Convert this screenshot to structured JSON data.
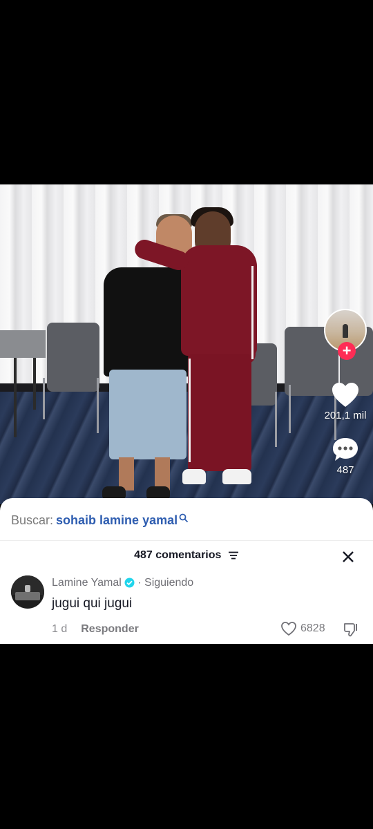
{
  "video": {
    "likes_count": "201,1 mil",
    "comments_count": "487"
  },
  "search": {
    "label": "Buscar:",
    "term": "sohaib lamine yamal"
  },
  "comments_sheet": {
    "header": "487 comentarios",
    "comments": [
      {
        "author": "Lamine Yamal",
        "status": "· Siguiendo",
        "text": "jugui qui jugui",
        "age": "1 d",
        "reply_label": "Responder",
        "likes": "6828"
      }
    ]
  },
  "colors": {
    "follow_red": "#fe2c55",
    "search_blue": "#2e5db0",
    "verified_blue": "#20d5ec"
  },
  "icons": [
    "plus-icon",
    "heart-icon",
    "comment-bubble-icon",
    "search-icon",
    "filter-icon",
    "close-icon",
    "verified-icon",
    "like-icon",
    "dislike-icon"
  ]
}
